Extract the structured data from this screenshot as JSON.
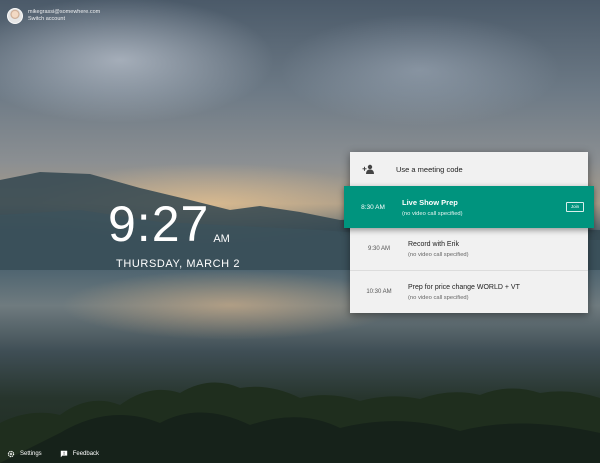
{
  "account": {
    "email": "mikegrassi@somewhere.com",
    "switch_label": "Switch account"
  },
  "clock": {
    "time": "9:27",
    "ampm": "AM",
    "date": "THURSDAY, MARCH 2"
  },
  "panel": {
    "meeting_code_label": "Use a meeting code",
    "events": [
      {
        "time": "8:30 AM",
        "title": "Live Show Prep",
        "subtitle": "(no video call specified)",
        "active": true,
        "action_label": "Join"
      },
      {
        "time": "9:30 AM",
        "title": "Record with Erik",
        "subtitle": "(no video call specified)"
      },
      {
        "time": "10:30 AM",
        "title": "Prep for price change WORLD + VT",
        "subtitle": "(no video call specified)"
      }
    ]
  },
  "footer": {
    "settings_label": "Settings",
    "feedback_label": "Feedback"
  },
  "colors": {
    "accent": "#00947e",
    "panel_bg": "#f1f1f1"
  },
  "icons": [
    "avatar",
    "person-add-icon",
    "gear-icon",
    "feedback-icon"
  ]
}
